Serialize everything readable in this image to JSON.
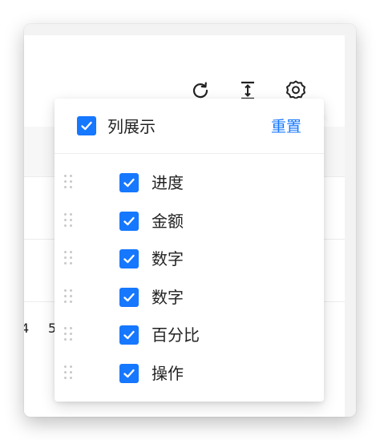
{
  "toolbar": {
    "icons": [
      "reload-icon",
      "column-height-icon",
      "setting-icon"
    ]
  },
  "background_table": {
    "partial_cells": [
      "4",
      "5"
    ]
  },
  "popover": {
    "header_label": "列展示",
    "header_checked": true,
    "reset_label": "重置",
    "items": [
      {
        "label": "进度",
        "checked": true
      },
      {
        "label": "金额",
        "checked": true
      },
      {
        "label": "数字",
        "checked": true
      },
      {
        "label": "数字",
        "checked": true
      },
      {
        "label": "百分比",
        "checked": true
      },
      {
        "label": "操作",
        "checked": true
      }
    ]
  },
  "colors": {
    "accent": "#1677ff",
    "text": "#222222",
    "divider": "#ececec"
  }
}
